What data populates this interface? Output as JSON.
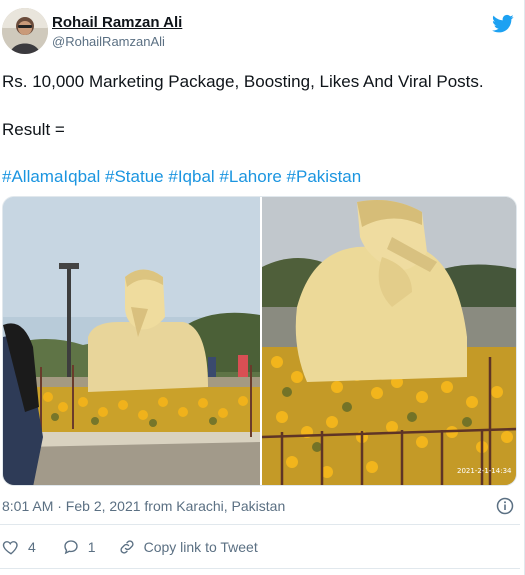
{
  "user": {
    "name": "Rohail Ramzan Ali",
    "handle": "@RohailRamzanAli"
  },
  "tweet": {
    "line1": "Rs. 10,000 Marketing Package, Boosting, Likes And Viral Posts.",
    "line2": "Result =",
    "hashtags": [
      "#AllamaIqbal",
      "#Statue",
      "#Iqbal",
      "#Lahore",
      "#Pakistan"
    ]
  },
  "media": {
    "photo_count": 2,
    "watermark": "2021-2-1-14:34"
  },
  "meta": {
    "timestamp": "8:01 AM · Feb 2, 2021 from Karachi, Pakistan"
  },
  "actions": {
    "likes": "4",
    "replies": "1",
    "copy_link_label": "Copy link to Tweet"
  },
  "icons": {
    "brand": "twitter-bird-icon",
    "info": "info-icon",
    "like": "heart-icon",
    "reply": "reply-icon",
    "link": "link-icon"
  },
  "colors": {
    "hashtag": "#1b95e0",
    "twitter_blue": "#1da1f2",
    "muted": "#5b7083"
  }
}
